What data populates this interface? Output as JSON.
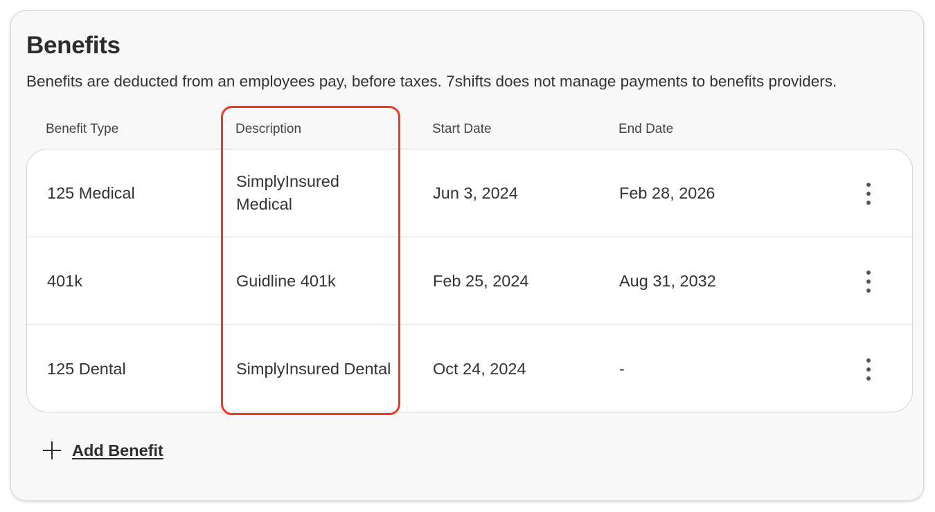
{
  "card": {
    "title": "Benefits",
    "subtitle": "Benefits are deducted from an employees pay, before taxes. 7shifts does not manage payments to benefits providers."
  },
  "table": {
    "headers": {
      "type": "Benefit Type",
      "description": "Description",
      "start": "Start Date",
      "end": "End Date"
    },
    "rows": [
      {
        "type": "125 Medical",
        "description": "SimplyInsured Medical",
        "start": "Jun 3, 2024",
        "end": "Feb 28, 2026",
        "menu_icon": "more-vertical-icon"
      },
      {
        "type": "401k",
        "description": "Guidline 401k",
        "start": "Feb 25, 2024",
        "end": "Aug 31, 2032",
        "menu_icon": "more-vertical-icon"
      },
      {
        "type": "125 Dental",
        "description": "SimplyInsured Dental",
        "start": "Oct 24, 2024",
        "end": "-",
        "menu_icon": "more-vertical-icon"
      }
    ]
  },
  "actions": {
    "add_label": "Add Benefit",
    "add_icon": "plus-icon"
  },
  "colors": {
    "highlight": "#ee3a23",
    "card_background": "#f8f8f8",
    "table_background": "#ffffff",
    "text": "#323232"
  }
}
